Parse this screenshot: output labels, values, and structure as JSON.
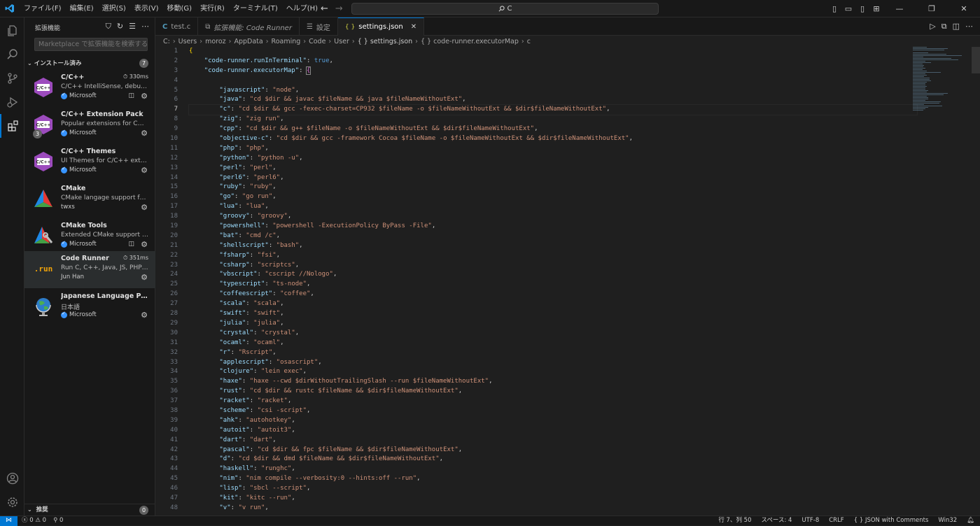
{
  "titlebar": {
    "menu": [
      "ファイル(F)",
      "編集(E)",
      "選択(S)",
      "表示(V)",
      "移動(G)",
      "実行(R)",
      "ターミナル(T)",
      "ヘルプ(H)"
    ],
    "search_text": "C"
  },
  "sidebar": {
    "title": "拡張機能",
    "search_placeholder": "Marketplace で拡張機能を検索する",
    "installed_label": "インストール済み",
    "installed_count": "7",
    "recommended_label": "推奨",
    "recommended_count": "0",
    "extensions": [
      {
        "name": "C/C++",
        "desc": "C/C++ IntelliSense, debuggi...",
        "publisher": "Microsoft",
        "time": "330ms",
        "icon": "cpp-icon"
      },
      {
        "name": "C/C++ Extension Pack",
        "desc": "Popular extensions for C++ ...",
        "publisher": "Microsoft",
        "count": "3",
        "icon": "cpp-icon"
      },
      {
        "name": "C/C++ Themes",
        "desc": "UI Themes for C/C++ exten...",
        "publisher": "Microsoft",
        "icon": "cpp-icon"
      },
      {
        "name": "CMake",
        "desc": "CMake langage support for ...",
        "publisher": "twxs",
        "icon": "cmake-icon"
      },
      {
        "name": "CMake Tools",
        "desc": "Extended CMake support in ...",
        "publisher": "Microsoft",
        "icon": "cmake-tools-icon"
      },
      {
        "name": "Code Runner",
        "desc": "Run C, C++, Java, JS, PHP, P...",
        "publisher": "Jun Han",
        "time": "351ms",
        "icon": "run-icon"
      },
      {
        "name": "Japanese Language Pack f...",
        "desc": "日本語",
        "publisher": "Microsoft",
        "icon": "globe-icon"
      }
    ]
  },
  "tabs": [
    {
      "label": "test.c",
      "type": "c"
    },
    {
      "label": "拡張機能: Code Runner",
      "type": "ext"
    },
    {
      "label": "設定",
      "type": "settings"
    },
    {
      "label": "settings.json",
      "type": "json",
      "active": true
    }
  ],
  "breadcrumb": [
    "C:",
    "Users",
    "moroz",
    "AppData",
    "Roaming",
    "Code",
    "User",
    "{ } settings.json",
    "{ } code-runner.executorMap",
    "c"
  ],
  "editor": {
    "current_line": 7,
    "lines": [
      {
        "n": "1"
      },
      {
        "n": "2"
      },
      {
        "n": "3"
      },
      {
        "n": "4"
      },
      {
        "n": "5"
      },
      {
        "n": "6"
      },
      {
        "n": "7"
      },
      {
        "n": "8"
      },
      {
        "n": "9"
      },
      {
        "n": "10"
      },
      {
        "n": "11"
      },
      {
        "n": "12"
      },
      {
        "n": "13"
      },
      {
        "n": "14"
      },
      {
        "n": "15"
      },
      {
        "n": "16"
      },
      {
        "n": "17"
      },
      {
        "n": "18"
      },
      {
        "n": "19"
      },
      {
        "n": "20"
      },
      {
        "n": "21"
      },
      {
        "n": "22"
      },
      {
        "n": "23"
      },
      {
        "n": "24"
      },
      {
        "n": "25"
      },
      {
        "n": "26"
      },
      {
        "n": "27"
      },
      {
        "n": "28"
      },
      {
        "n": "29"
      },
      {
        "n": "30"
      },
      {
        "n": "31"
      },
      {
        "n": "32"
      },
      {
        "n": "33"
      },
      {
        "n": "34"
      },
      {
        "n": "35"
      },
      {
        "n": "36"
      },
      {
        "n": "37"
      },
      {
        "n": "38"
      },
      {
        "n": "39"
      },
      {
        "n": "40"
      },
      {
        "n": "41"
      },
      {
        "n": "42"
      },
      {
        "n": "43"
      },
      {
        "n": "44"
      },
      {
        "n": "45"
      },
      {
        "n": "46"
      },
      {
        "n": "47"
      },
      {
        "n": "48"
      }
    ],
    "top": {
      "open": "{",
      "runInTerminal_key": "\"code-runner.runInTerminal\"",
      "runInTerminal_val": "true",
      "executorMap_key": "\"code-runner.executorMap\""
    },
    "entries": [
      [
        "javascript",
        "node"
      ],
      [
        "java",
        "cd $dir && javac $fileName && java $fileNameWithoutExt"
      ],
      [
        "c",
        "cd $dir && gcc -fexec-charset=CP932 $fileName -o $fileNameWithoutExt && $dir$fileNameWithoutExt"
      ],
      [
        "zig",
        "zig run"
      ],
      [
        "cpp",
        "cd $dir && g++ $fileName -o $fileNameWithoutExt && $dir$fileNameWithoutExt"
      ],
      [
        "objective-c",
        "cd $dir && gcc -framework Cocoa $fileName -o $fileNameWithoutExt && $dir$fileNameWithoutExt"
      ],
      [
        "php",
        "php"
      ],
      [
        "python",
        "python -u"
      ],
      [
        "perl",
        "perl"
      ],
      [
        "perl6",
        "perl6"
      ],
      [
        "ruby",
        "ruby"
      ],
      [
        "go",
        "go run"
      ],
      [
        "lua",
        "lua"
      ],
      [
        "groovy",
        "groovy"
      ],
      [
        "powershell",
        "powershell -ExecutionPolicy ByPass -File"
      ],
      [
        "bat",
        "cmd /c"
      ],
      [
        "shellscript",
        "bash"
      ],
      [
        "fsharp",
        "fsi"
      ],
      [
        "csharp",
        "scriptcs"
      ],
      [
        "vbscript",
        "cscript //Nologo"
      ],
      [
        "typescript",
        "ts-node"
      ],
      [
        "coffeescript",
        "coffee"
      ],
      [
        "scala",
        "scala"
      ],
      [
        "swift",
        "swift"
      ],
      [
        "julia",
        "julia"
      ],
      [
        "crystal",
        "crystal"
      ],
      [
        "ocaml",
        "ocaml"
      ],
      [
        "r",
        "Rscript"
      ],
      [
        "applescript",
        "osascript"
      ],
      [
        "clojure",
        "lein exec"
      ],
      [
        "haxe",
        "haxe --cwd $dirWithoutTrailingSlash --run $fileNameWithoutExt"
      ],
      [
        "rust",
        "cd $dir && rustc $fileName && $dir$fileNameWithoutExt"
      ],
      [
        "racket",
        "racket"
      ],
      [
        "scheme",
        "csi -script"
      ],
      [
        "ahk",
        "autohotkey"
      ],
      [
        "autoit",
        "autoit3"
      ],
      [
        "dart",
        "dart"
      ],
      [
        "pascal",
        "cd $dir && fpc $fileName && $dir$fileNameWithoutExt"
      ],
      [
        "d",
        "cd $dir && dmd $fileName && $dir$fileNameWithoutExt"
      ],
      [
        "haskell",
        "runghc"
      ],
      [
        "nim",
        "nim compile --verbosity:0 --hints:off --run"
      ],
      [
        "lisp",
        "sbcl --script"
      ],
      [
        "kit",
        "kitc --run"
      ],
      [
        "v",
        "v run"
      ]
    ]
  },
  "statusbar": {
    "errors": "0",
    "warnings": "0",
    "ports": "0",
    "position": "行 7、列 50",
    "spaces": "スペース: 4",
    "encoding": "UTF-8",
    "eol": "CRLF",
    "language": "JSON with Comments",
    "platform": "Win32"
  },
  "colors": {
    "accent": "#0078d4",
    "key": "#9cdcfe",
    "string": "#ce9178",
    "bool": "#569cd6"
  }
}
